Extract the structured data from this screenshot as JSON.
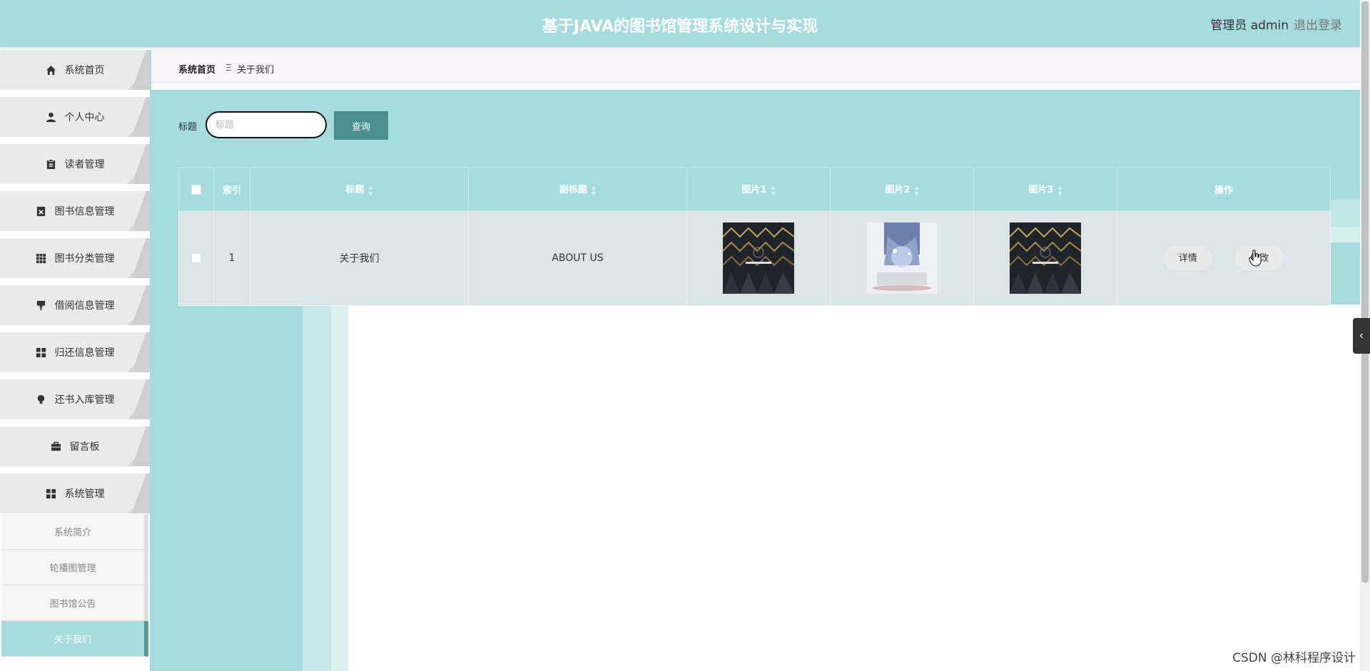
{
  "header": {
    "title": "基于JAVA的图书馆管理系统设计与实现",
    "user_label": "管理员 admin",
    "logout_label": "退出登录"
  },
  "sidebar": {
    "items": [
      {
        "label": "系统首页",
        "icon": "home-icon"
      },
      {
        "label": "个人中心",
        "icon": "user-icon"
      },
      {
        "label": "读者管理",
        "icon": "clipboard-icon"
      },
      {
        "label": "图书信息管理",
        "icon": "book-x-icon"
      },
      {
        "label": "图书分类管理",
        "icon": "grid-icon"
      },
      {
        "label": "借阅信息管理",
        "icon": "brush-icon"
      },
      {
        "label": "归还信息管理",
        "icon": "apps-icon"
      },
      {
        "label": "还书入库管理",
        "icon": "bulb-icon"
      },
      {
        "label": "留言板",
        "icon": "briefcase-icon"
      },
      {
        "label": "系统管理",
        "icon": "apps-icon"
      }
    ],
    "submenu": [
      {
        "label": "系统简介"
      },
      {
        "label": "轮播图管理"
      },
      {
        "label": "图书馆公告"
      },
      {
        "label": "关于我们"
      }
    ]
  },
  "breadcrumb": {
    "home": "系统首页",
    "separator": "Ξ",
    "current": "关于我们"
  },
  "search": {
    "label": "标题",
    "placeholder": "标题",
    "value": "",
    "button_label": "查询"
  },
  "table": {
    "headers": [
      "索引",
      "标题",
      "副标题",
      "图片1",
      "图片2",
      "图片3",
      "操作"
    ],
    "rows": [
      {
        "index": "1",
        "title": "关于我们",
        "subtitle": "ABOUT US",
        "detail_label": "详情",
        "edit_label": "修改"
      }
    ]
  },
  "toggle_icon": "‹",
  "watermark": "CSDN @林科程序设计",
  "colors": {
    "accent": "#a6dcde",
    "button": "#4b8f90",
    "active_submenu": "#a6dcde"
  }
}
